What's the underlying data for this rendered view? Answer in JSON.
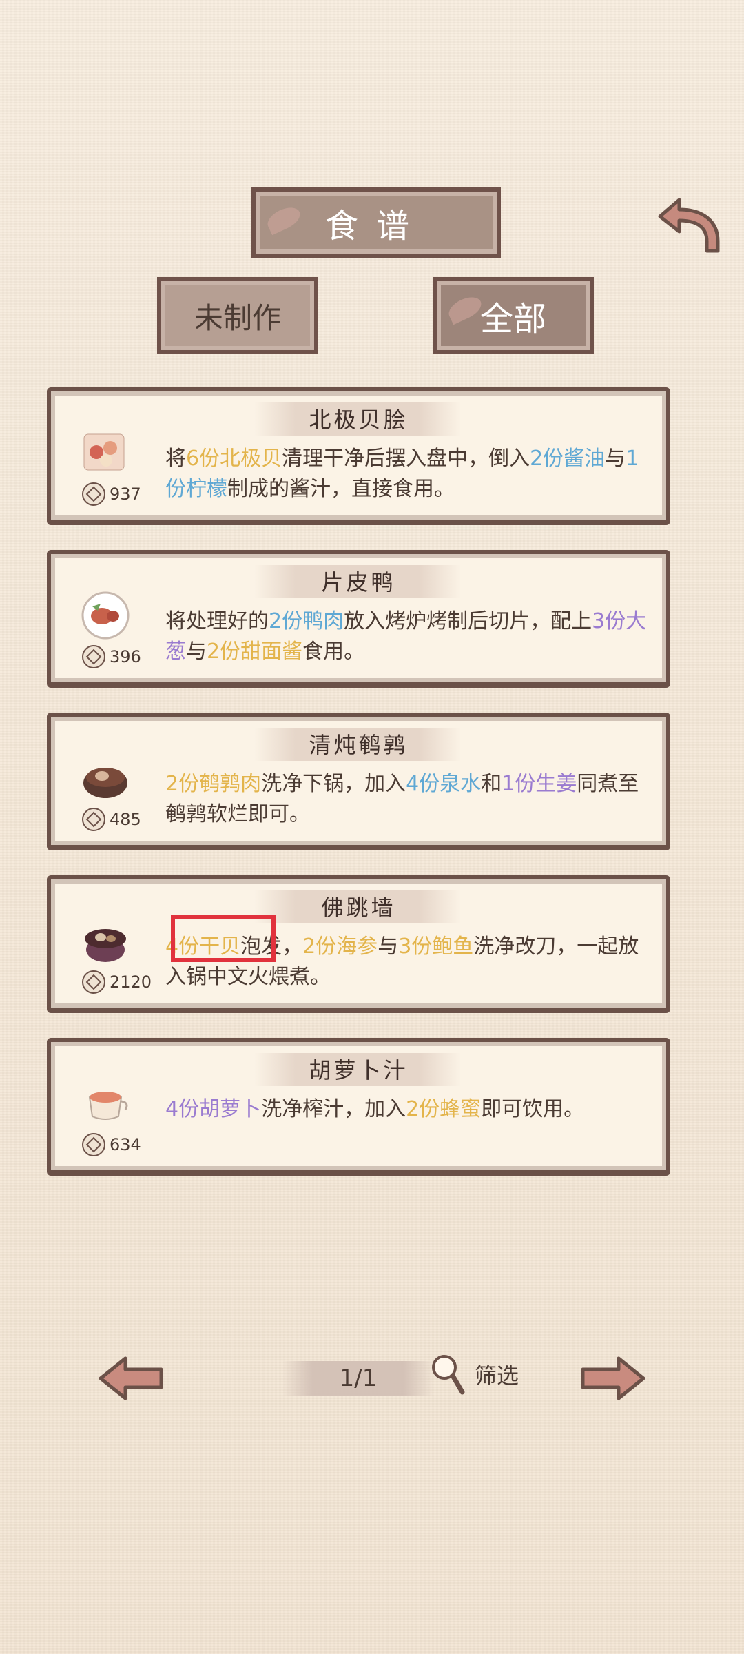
{
  "header": {
    "title": "食谱"
  },
  "tabs": {
    "left": "未制作",
    "right": "全部"
  },
  "recipes": [
    {
      "name": "北极贝脍",
      "price": "937",
      "desc": [
        {
          "t": "将",
          "c": ""
        },
        {
          "t": "6份北极贝",
          "c": "yellow"
        },
        {
          "t": "清理干净后摆入盘中，倒入",
          "c": ""
        },
        {
          "t": "2份酱油",
          "c": "blue"
        },
        {
          "t": "与",
          "c": ""
        },
        {
          "t": "1份柠檬",
          "c": "blue"
        },
        {
          "t": "制成的酱汁，直接食用。",
          "c": ""
        }
      ]
    },
    {
      "name": "片皮鸭",
      "price": "396",
      "desc": [
        {
          "t": "将处理好的",
          "c": ""
        },
        {
          "t": "2份鸭肉",
          "c": "blue"
        },
        {
          "t": "放入烤炉烤制后切片，配上",
          "c": ""
        },
        {
          "t": "3份大葱",
          "c": "purple"
        },
        {
          "t": "与",
          "c": ""
        },
        {
          "t": "2份甜面酱",
          "c": "yellow"
        },
        {
          "t": "食用。",
          "c": ""
        }
      ]
    },
    {
      "name": "清炖鹌鹑",
      "price": "485",
      "desc": [
        {
          "t": "2份鹌鹑肉",
          "c": "yellow"
        },
        {
          "t": "洗净下锅，加入",
          "c": ""
        },
        {
          "t": "4份泉水",
          "c": "blue"
        },
        {
          "t": "和",
          "c": ""
        },
        {
          "t": "1份生姜",
          "c": "purple"
        },
        {
          "t": "同煮至鹌鹑软烂即可。",
          "c": ""
        }
      ]
    },
    {
      "name": "佛跳墙",
      "price": "2120",
      "desc": [
        {
          "t": "4份干贝",
          "c": "yellow"
        },
        {
          "t": "泡发，",
          "c": ""
        },
        {
          "t": "2份海参",
          "c": "yellow"
        },
        {
          "t": "与",
          "c": ""
        },
        {
          "t": "3份鲍鱼",
          "c": "yellow"
        },
        {
          "t": "洗净改刀，一起放入锅中文火煨煮。",
          "c": ""
        }
      ]
    },
    {
      "name": "胡萝卜汁",
      "price": "634",
      "desc": [
        {
          "t": "4份胡萝卜",
          "c": "purple"
        },
        {
          "t": "洗净榨汁，加入",
          "c": ""
        },
        {
          "t": "2份蜂蜜",
          "c": "yellow"
        },
        {
          "t": "即可饮用。",
          "c": ""
        }
      ]
    }
  ],
  "footer": {
    "page": "1/1",
    "filter_label": "筛选"
  },
  "colors": {
    "highlight": "#e1323d",
    "accent_yellow": "#e3b44b",
    "accent_blue": "#5fa8d4",
    "accent_purple": "#9a7bd0"
  }
}
